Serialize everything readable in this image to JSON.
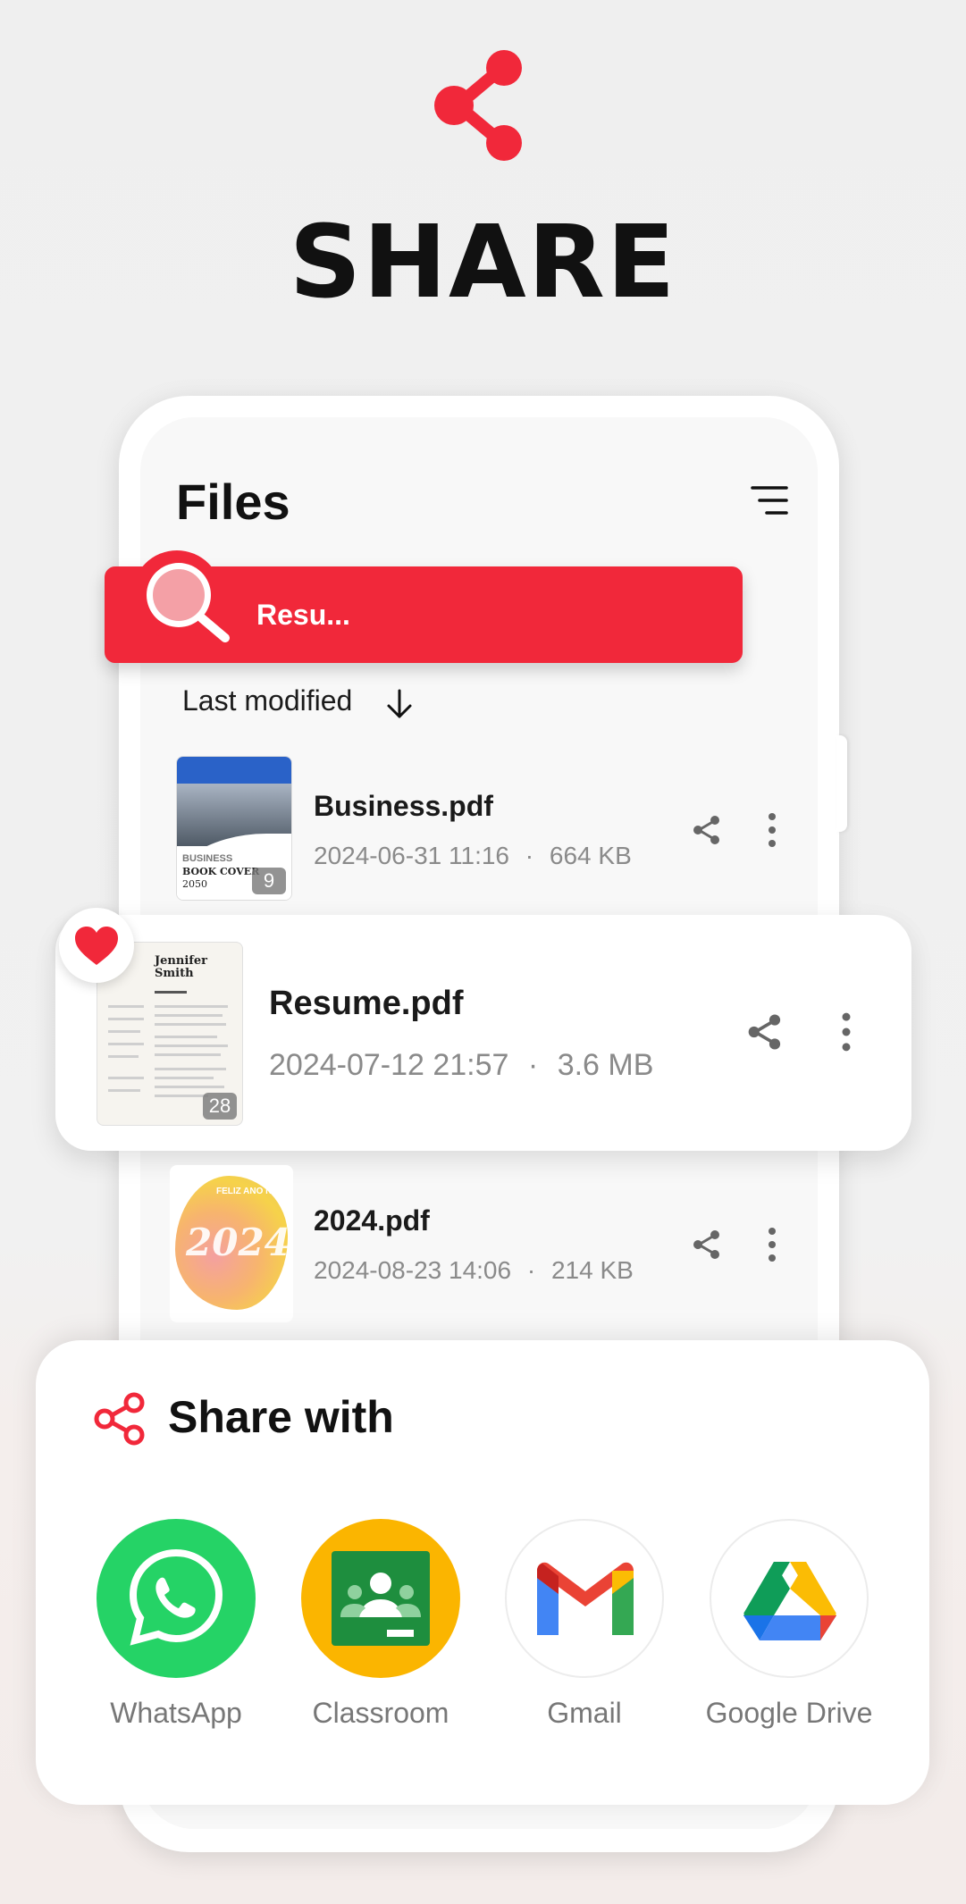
{
  "hero": {
    "title": "SHARE"
  },
  "files": {
    "title": "Files",
    "search_value": "Resu...",
    "sort_label": "Last modified"
  },
  "rows": [
    {
      "name": "Business.pdf",
      "date": "2024-06-31 11:16",
      "size": "664 KB",
      "pages": "9",
      "thumb_text": [
        "BUSINESS",
        "BOOK COVER",
        "2050"
      ]
    },
    {
      "name": "Resume.pdf",
      "date": "2024-07-12 21:57",
      "size": "3.6 MB",
      "pages": "28",
      "thumb_text": [
        "Jennifer",
        "Smith"
      ]
    },
    {
      "name": "2024.pdf",
      "date": "2024-08-23 14:06",
      "size": "214 KB",
      "thumb_text": [
        "2024",
        "FELIZ ANO NOVO"
      ]
    }
  ],
  "separator": "·",
  "share_sheet": {
    "title": "Share with",
    "apps": [
      {
        "label": "WhatsApp",
        "color": "#25d366"
      },
      {
        "label": "Classroom",
        "color": "#fbb500"
      },
      {
        "label": "Gmail",
        "color": "#ffffff"
      },
      {
        "label": "Google Drive",
        "color": "#ffffff"
      }
    ]
  },
  "colors": {
    "accent": "#f1283a",
    "text": "#111111",
    "muted": "#8a8a8a"
  }
}
